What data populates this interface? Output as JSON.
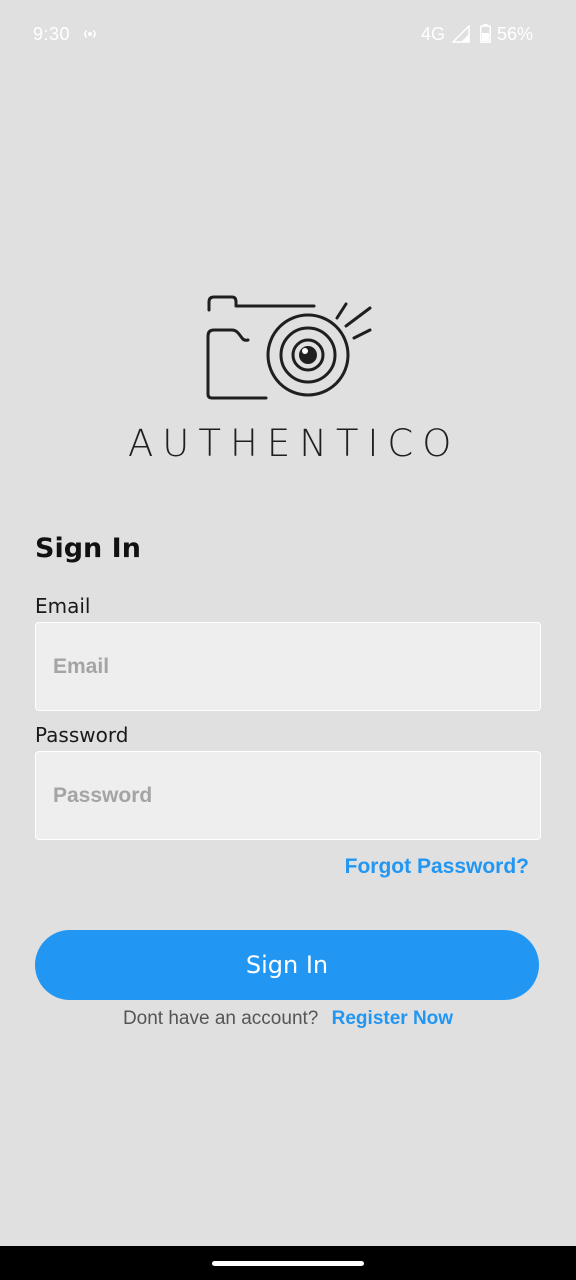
{
  "status_bar": {
    "time": "9:30",
    "network": "4G",
    "battery": "56%",
    "icons": [
      "hotspot-icon",
      "signal-icon",
      "battery-icon"
    ]
  },
  "brand": {
    "name": "AUTHENTICO",
    "logo": "camera-logo-icon"
  },
  "form": {
    "title": "Sign In",
    "email_label": "Email",
    "email_placeholder": "Email",
    "email_value": "",
    "password_label": "Password",
    "password_placeholder": "Password",
    "password_value": "",
    "forgot_label": "Forgot Password?",
    "submit_label": "Sign In",
    "register_prompt": "Dont have an account?",
    "register_label": "Register Now"
  },
  "colors": {
    "background": "#e0e0e0",
    "accent": "#2196f3",
    "input_bg": "#eeeeee"
  }
}
